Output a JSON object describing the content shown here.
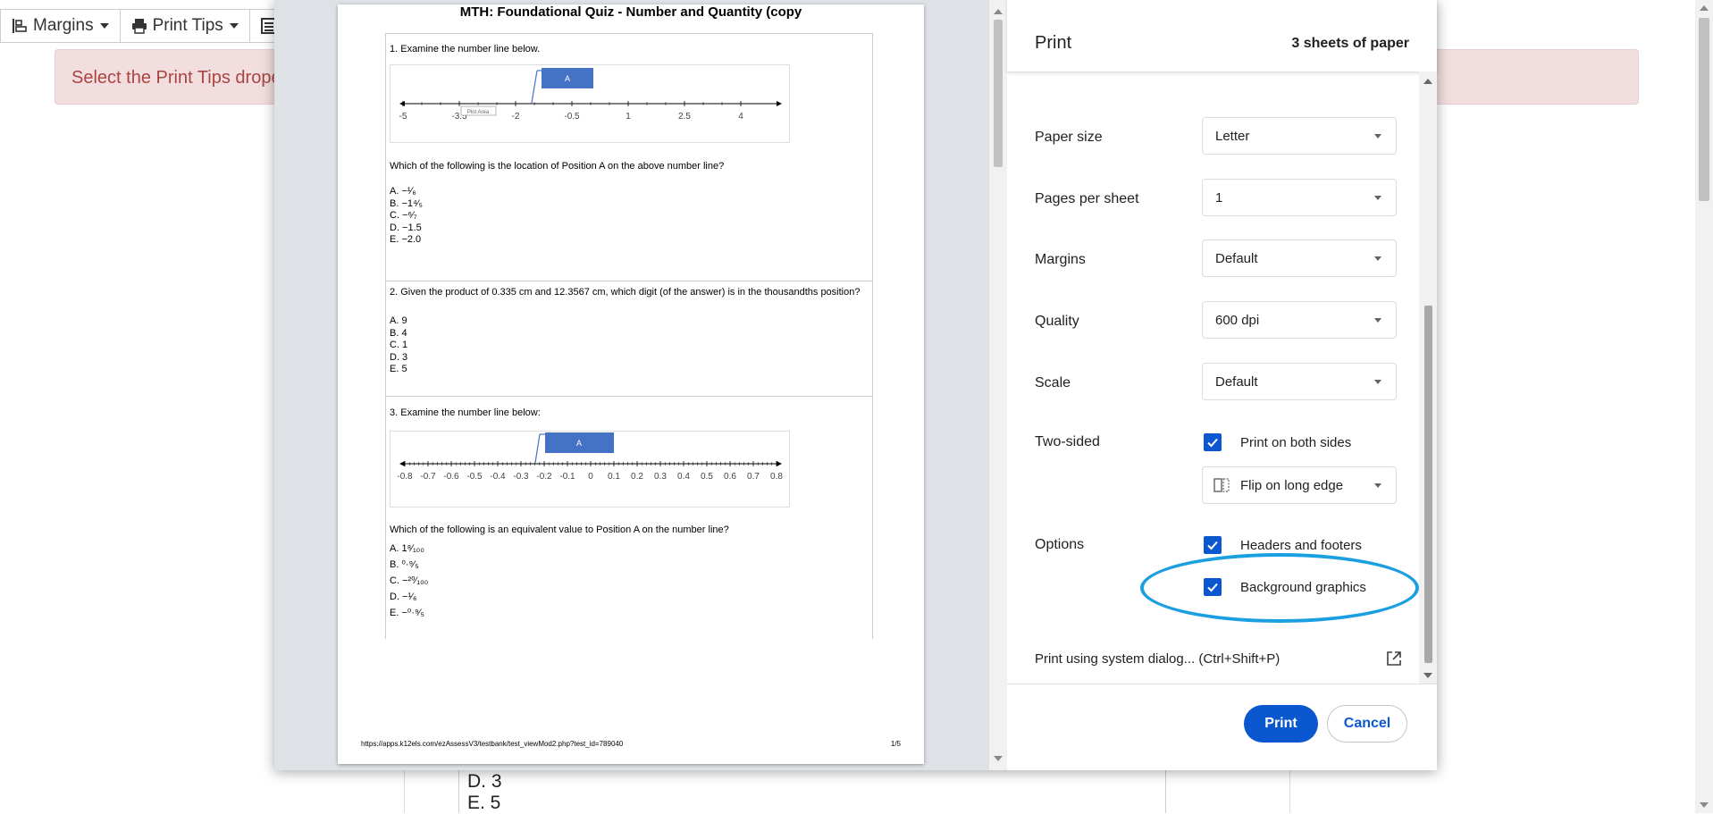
{
  "toolbar": {
    "margins_label": "Margins",
    "print_tips_label": "Print Tips"
  },
  "alert": {
    "text": "Select the Print Tips drope"
  },
  "background_answers": [
    "D. 3",
    "E. 5"
  ],
  "preview": {
    "title": "MTH: Foundational Quiz - Number and Quantity (copy",
    "q1": {
      "prompt": "1. Examine the number line below.",
      "marker_label": "A",
      "plot_area_label": "Plot Area",
      "ticks": [
        "-5",
        "-3.5",
        "-2",
        "-0.5",
        "1",
        "2.5",
        "4"
      ],
      "question": "Which of the following is the location of Position A on the above number line?",
      "answers": [
        "A. −¹⁄₆",
        "B. −1⁴⁄₅",
        "C. −⁶⁄₇",
        "D. −1.5",
        "E. −2.0"
      ]
    },
    "q2": {
      "prompt": "2. Given the product of 0.335 cm and 12.3567 cm, which digit (of the answer) is in the thousandths position?",
      "answers": [
        "A. 9",
        "B. 4",
        "C. 1",
        "D. 3",
        "E. 5"
      ]
    },
    "q3": {
      "prompt": "3. Examine the number line below:",
      "marker_label": "A",
      "ticks": [
        "-0.8",
        "-0.7",
        "-0.6",
        "-0.5",
        "-0.4",
        "-0.3",
        "-0.2",
        "-0.1",
        "0",
        "0.1",
        "0.2",
        "0.3",
        "0.4",
        "0.5",
        "0.6",
        "0.7",
        "0.8"
      ],
      "question": "Which of the following is an equivalent value to Position A on the number line?",
      "answers": [
        "A. 1⁸⁄₁₀₀",
        "B. ⁰·⁹⁄₅",
        "C. −²⁰⁄₁₀₀",
        "D. −¹⁄₆",
        "E. −⁰·⁹⁄₅"
      ]
    },
    "footer_url": "https://apps.k12els.com/ezAssessV3/testbank/test_viewMod2.php?test_id=789040",
    "page_number": "1/5"
  },
  "settings": {
    "title": "Print",
    "sheets": "3 sheets of paper",
    "paper_size": {
      "label": "Paper size",
      "value": "Letter"
    },
    "pages_per_sheet": {
      "label": "Pages per sheet",
      "value": "1"
    },
    "margins": {
      "label": "Margins",
      "value": "Default"
    },
    "quality": {
      "label": "Quality",
      "value": "600 dpi"
    },
    "scale": {
      "label": "Scale",
      "value": "Default"
    },
    "two_sided": {
      "label": "Two-sided",
      "checkbox_label": "Print on both sides",
      "checked": true,
      "flip_value": "Flip on long edge"
    },
    "options": {
      "label": "Options",
      "headers_footers": {
        "label": "Headers and footers",
        "checked": true
      },
      "background_graphics": {
        "label": "Background graphics",
        "checked": true
      }
    },
    "system_dialog": "Print using system dialog... (Ctrl+Shift+P)",
    "print_button": "Print",
    "cancel_button": "Cancel"
  },
  "colors": {
    "accent": "#0b57d0",
    "highlight": "#1a9fe0",
    "alert_bg": "#f2dede",
    "alert_text": "#a94442"
  }
}
